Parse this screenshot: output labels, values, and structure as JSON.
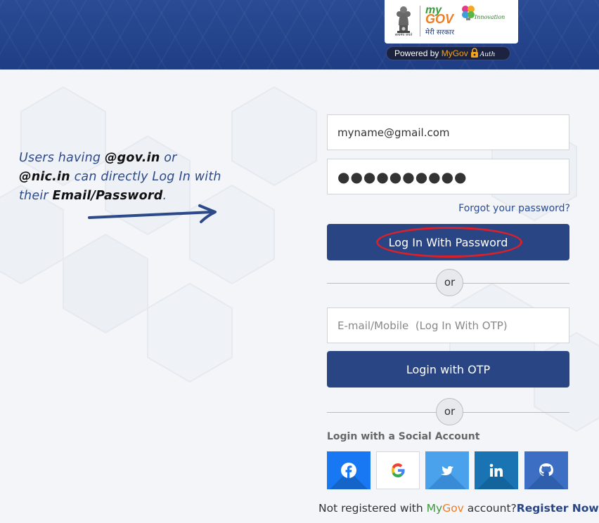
{
  "header": {
    "emblem_caption": "सत्यमेव जयते",
    "logo_my": "my",
    "logo_gov": "GOV",
    "logo_tagline": "मेरी सरकार",
    "logo_innovation": "Innovation",
    "powered_by_prefix": "Powered by ",
    "powered_by_brand": "MyGov",
    "powered_by_auth": "Auth"
  },
  "note": {
    "t1": "Users having ",
    "b1": "@gov.in",
    "t2": " or ",
    "b2": "@nic.in",
    "t3": " can directly Log In with their ",
    "b3": "Email/Password",
    "t4": "."
  },
  "form": {
    "email_value": "myname@gmail.com",
    "password_value": "●●●●●●●●●●",
    "forgot_label": "Forgot your password?",
    "login_password_label": "Log In With Password",
    "or_label_1": "or",
    "otp_placeholder": "E-mail/Mobile  (Log In With OTP)",
    "login_otp_label": "Login with OTP",
    "or_label_2": "or",
    "social_heading": "Login with a Social Account",
    "social_buttons": [
      "facebook",
      "google",
      "twitter",
      "linkedin",
      "github"
    ]
  },
  "footer": {
    "prefix": "Not registered with ",
    "brand_my": "My",
    "brand_gov": "Gov",
    "suffix": " account?",
    "register_label": "Register Now"
  },
  "colors": {
    "header_blue": "#2a4c95",
    "button_blue": "#2a4583",
    "highlight_red": "#d8212a",
    "facebook": "#1877f2",
    "twitter": "#4aa1ec",
    "linkedin": "#1a74b3",
    "github": "#3c6fc4"
  }
}
